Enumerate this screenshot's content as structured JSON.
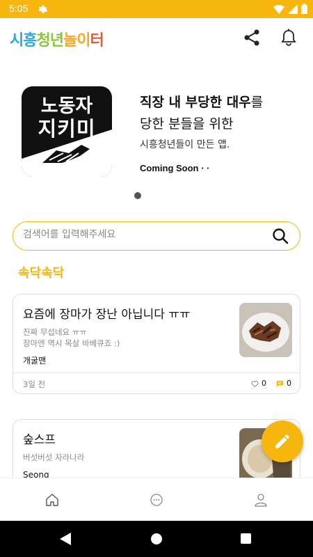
{
  "status_bar": {
    "time": "5:05"
  },
  "app": {
    "logo_chars": [
      "시",
      "흥",
      "청",
      "년",
      "놀",
      "이",
      "터"
    ]
  },
  "banner": {
    "image_line1": "노동자",
    "image_line2": "지키미",
    "headline_bold": "직장 내 부당한 대우",
    "headline_rest": "를",
    "line2": "당한 분들을 위한",
    "line3": "시흥청년들이 만든 앱.",
    "line4": "Coming Soon · ·"
  },
  "search": {
    "placeholder": "검색어를 입력해주세요"
  },
  "section": {
    "title": "속닥속닥"
  },
  "posts": [
    {
      "title": "요즘에 장마가 장난 아닙니다 ㅠㅠ",
      "body_line1": "진짜 무섭네요 ㅠㅠ",
      "body_line2": "장마엔 역시 목살 바베큐죠 :)",
      "author": "개굴맨",
      "date": "3일 전",
      "likes": "0",
      "comments": "0"
    },
    {
      "title": "숲스프",
      "body_line1": "버섯버섯 자라나라",
      "author": "Seong"
    }
  ],
  "colors": {
    "accent": "#f6b60e"
  },
  "icons": [
    "settings-gear-icon",
    "wifi-icon",
    "signal-icon",
    "battery-icon",
    "share-icon",
    "bell-icon",
    "search-icon",
    "heart-icon",
    "comment-icon",
    "pencil-icon",
    "home-icon",
    "chat-icon",
    "person-icon",
    "back-icon"
  ]
}
